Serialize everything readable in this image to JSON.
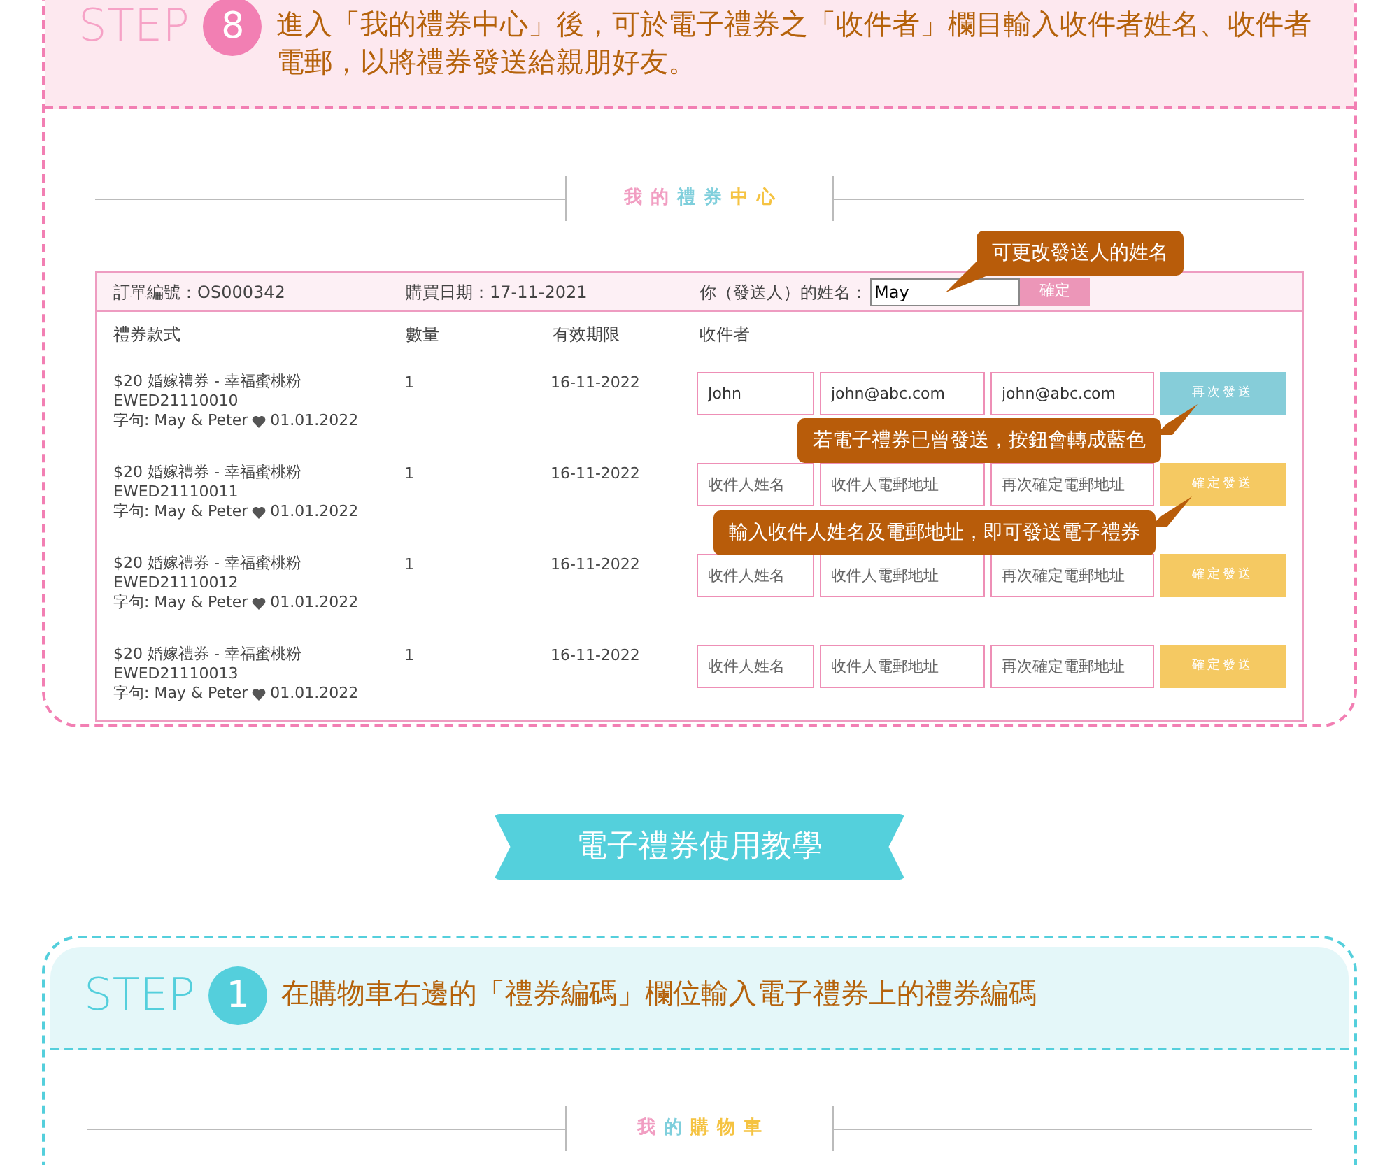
{
  "step8": {
    "step_label": "STEP",
    "step_number": "8",
    "instruction": "進入「我的禮券中心」後，可於電子禮券之「收件者」欄目輸入收件者姓名、收件者電郵，以將禮券發送給親朋好友。"
  },
  "center_title": [
    {
      "text": "我",
      "color": "#f19ec2"
    },
    {
      "text": "的",
      "color": "#f19ec2"
    },
    {
      "text": "禮",
      "color": "#7fcfdc"
    },
    {
      "text": "券",
      "color": "#7fcfdc"
    },
    {
      "text": "中",
      "color": "#f5c342"
    },
    {
      "text": "心",
      "color": "#f5c342"
    }
  ],
  "order": {
    "order_label": "訂單編號：OS000342",
    "date_label": "購買日期：17-11-2021",
    "sender_label": "你（發送人）的姓名：",
    "sender_value": "May",
    "confirm_button": "確定"
  },
  "columns": [
    "禮券款式",
    "數量",
    "有效期限",
    "收件者"
  ],
  "rows": [
    {
      "item": "$20 婚嫁禮券 - 幸福蜜桃粉",
      "code": "EWED21110010",
      "message": "字句: May & Peter",
      "message_date": "01.01.2022",
      "quantity": "1",
      "expiry": "16-11-2022",
      "recipient_name": {
        "value": "John"
      },
      "recipient_email": {
        "value": "john@abc.com"
      },
      "recipient_email_confirm": {
        "value": "john@abc.com"
      },
      "button": "再次發送",
      "sent": true
    },
    {
      "item": "$20 婚嫁禮券 - 幸福蜜桃粉",
      "code": "EWED21110011",
      "message": "字句: May & Peter",
      "message_date": "01.01.2022",
      "quantity": "1",
      "expiry": "16-11-2022",
      "recipient_name": {
        "placeholder": "收件人姓名"
      },
      "recipient_email": {
        "placeholder": "收件人電郵地址"
      },
      "recipient_email_confirm": {
        "placeholder": "再次確定電郵地址"
      },
      "button": "確定發送",
      "sent": false
    },
    {
      "item": "$20 婚嫁禮券 - 幸福蜜桃粉",
      "code": "EWED21110012",
      "message": "字句: May & Peter",
      "message_date": "01.01.2022",
      "quantity": "1",
      "expiry": "16-11-2022",
      "recipient_name": {
        "placeholder": "收件人姓名"
      },
      "recipient_email": {
        "placeholder": "收件人電郵地址"
      },
      "recipient_email_confirm": {
        "placeholder": "再次確定電郵地址"
      },
      "button": "確定發送",
      "sent": false
    },
    {
      "item": "$20 婚嫁禮券 - 幸福蜜桃粉",
      "code": "EWED21110013",
      "message": "字句: May & Peter",
      "message_date": "01.01.2022",
      "quantity": "1",
      "expiry": "16-11-2022",
      "recipient_name": {
        "placeholder": "收件人姓名"
      },
      "recipient_email": {
        "placeholder": "收件人電郵地址"
      },
      "recipient_email_confirm": {
        "placeholder": "再次確定電郵地址"
      },
      "button": "確定發送",
      "sent": false
    }
  ],
  "callouts": [
    {
      "text": "可更改發送人的姓名"
    },
    {
      "text": "若電子禮券已曾發送，按鈕會轉成藍色"
    },
    {
      "text": "輸入收件人姓名及電郵地址，即可發送電子禮券"
    }
  ],
  "banner": "電子禮券使用教學",
  "step1": {
    "step_label": "STEP",
    "step_number": "1",
    "instruction": "在購物車右邊的「禮券編碼」欄位輸入電子禮券上的禮券編碼"
  },
  "cart_title": [
    {
      "text": "我",
      "color": "#f19ec2"
    },
    {
      "text": "的",
      "color": "#7fcfdc"
    },
    {
      "text": "購",
      "color": "#f5c342"
    },
    {
      "text": "物",
      "color": "#f5c342"
    },
    {
      "text": "車",
      "color": "#f5c342"
    }
  ]
}
